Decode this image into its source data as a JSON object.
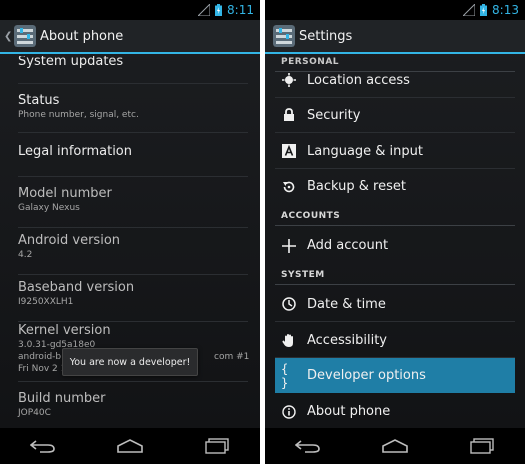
{
  "left": {
    "status": {
      "time": "8:11"
    },
    "action_bar": {
      "title": "About phone"
    },
    "items": [
      {
        "title": "System updates",
        "subtitle": ""
      },
      {
        "title": "Status",
        "subtitle": "Phone number, signal, etc."
      },
      {
        "title": "Legal information",
        "subtitle": ""
      },
      {
        "title": "Model number",
        "subtitle": "Galaxy Nexus"
      },
      {
        "title": "Android version",
        "subtitle": "4.2"
      },
      {
        "title": "Baseband version",
        "subtitle": "I9250XXLH1"
      },
      {
        "title": "Kernel version",
        "subtitle_lines": [
          "3.0.31-gd5a18e0",
          "android-b",
          "Fri Nov 2 1"
        ],
        "subtitle_right": "com #1"
      },
      {
        "title": "Build number",
        "subtitle": "JOP40C"
      }
    ],
    "toast": "You are now a developer!"
  },
  "right": {
    "status": {
      "time": "8:13"
    },
    "action_bar": {
      "title": "Settings"
    },
    "clipped_header": "PERSONAL",
    "rows": [
      {
        "label": "Location access",
        "icon": "location-icon"
      },
      {
        "label": "Security",
        "icon": "lock-icon"
      },
      {
        "label": "Language & input",
        "icon": "language-icon"
      },
      {
        "label": "Backup & reset",
        "icon": "backup-icon"
      },
      {
        "label": "Add account",
        "icon": "add-icon"
      },
      {
        "label": "Date & time",
        "icon": "clock-icon"
      },
      {
        "label": "Accessibility",
        "icon": "hand-icon"
      },
      {
        "label": "Developer options",
        "icon": "braces-icon"
      },
      {
        "label": "About phone",
        "icon": "info-icon"
      }
    ],
    "sections": {
      "accounts": "ACCOUNTS",
      "system": "SYSTEM"
    },
    "highlight_color": "#1f7ea6"
  },
  "colors": {
    "accent": "#33b5e5",
    "background": "#151719"
  }
}
